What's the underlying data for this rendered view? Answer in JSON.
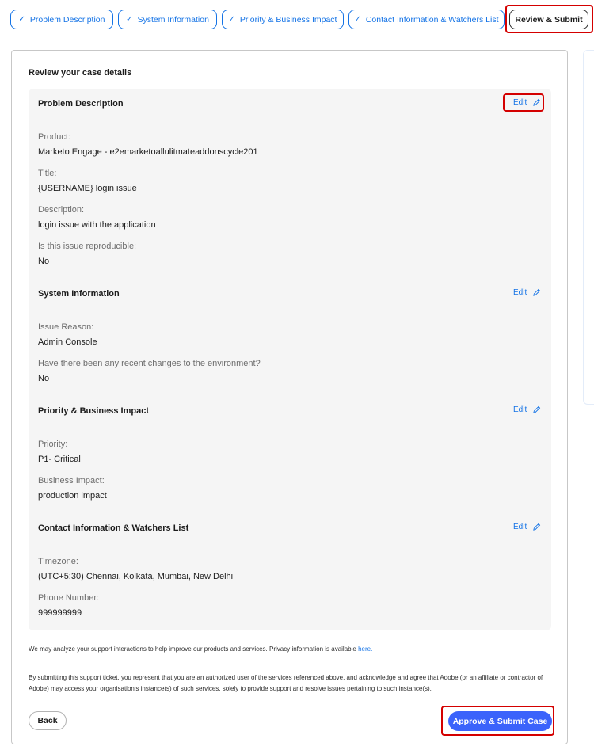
{
  "tabs": [
    {
      "label": "Problem Description",
      "check": "✓"
    },
    {
      "label": "System Information",
      "check": "✓"
    },
    {
      "label": "Priority & Business Impact",
      "check": "✓"
    },
    {
      "label": "Contact Information & Watchers List",
      "check": "✓"
    },
    {
      "label": "Review & Submit"
    }
  ],
  "review": {
    "title": "Review your case details",
    "edit_label": "Edit",
    "sections": [
      {
        "title": "Problem Description",
        "fields": [
          {
            "label": "Product:",
            "value": "Marketo Engage - e2emarketoallulitmateaddonscycle201"
          },
          {
            "label": "Title:",
            "value": "{USERNAME} login issue"
          },
          {
            "label": "Description:",
            "value": "login issue with the application"
          },
          {
            "label": "Is this issue reproducible:",
            "value": "No"
          }
        ]
      },
      {
        "title": "System Information",
        "fields": [
          {
            "label": "Issue Reason:",
            "value": "Admin Console"
          },
          {
            "label": "Have there been any recent changes to the environment?",
            "value": "No"
          }
        ]
      },
      {
        "title": "Priority & Business Impact",
        "fields": [
          {
            "label": "Priority:",
            "value": "P1- Critical"
          },
          {
            "label": "Business Impact:",
            "value": "production impact"
          }
        ]
      },
      {
        "title": "Contact Information & Watchers List",
        "fields": [
          {
            "label": "Timezone:",
            "value": "(UTC+5:30) Chennai, Kolkata, Mumbai, New Delhi"
          },
          {
            "label": "Phone Number:",
            "value": "999999999"
          }
        ]
      }
    ]
  },
  "footer": {
    "privacy_text": "We may analyze your support interactions to help improve our products and services. Privacy information is available",
    "privacy_link": "here.",
    "legal_text": "By submitting this support ticket, you represent that you are an authorized user of the services referenced above, and acknowledge and agree that Adobe (or an affiliate or contractor of Adobe) may access your organisation's instance(s) of such services, solely to provide support and resolve issues pertaining to such instance(s).",
    "back_label": "Back",
    "submit_label": "Approve & Submit Case"
  },
  "colors": {
    "accent": "#1473e6",
    "submit": "#3b63fb",
    "highlight": "#d40000"
  }
}
